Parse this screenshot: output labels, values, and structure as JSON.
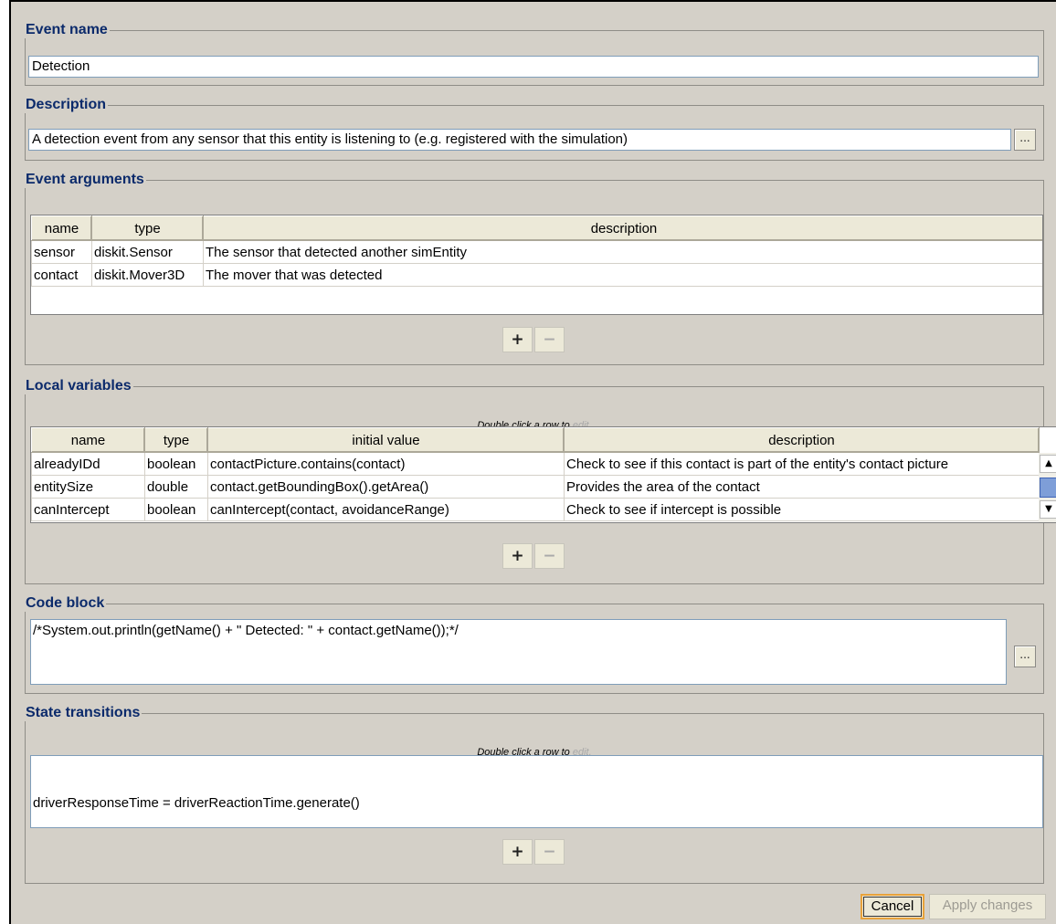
{
  "event_name": {
    "legend": "Event name",
    "value": "Detection"
  },
  "description": {
    "legend": "Description",
    "value": "A detection event from any sensor that this entity is listening to (e.g. registered with the simulation)",
    "more_label": "..."
  },
  "hint": {
    "prefix": "Double click a row to",
    "edit": "edit."
  },
  "event_arguments": {
    "legend": "Event arguments",
    "columns": [
      "name",
      "type",
      "description"
    ],
    "rows": [
      [
        "sensor",
        "diskit.Sensor",
        "The sensor that detected another simEntity"
      ],
      [
        "contact",
        "diskit.Mover3D",
        "The mover that was detected"
      ]
    ]
  },
  "local_variables": {
    "legend": "Local variables",
    "columns": [
      "name",
      "type",
      "initial value",
      "description"
    ],
    "rows": [
      [
        "alreadyIDd",
        "boolean",
        "contactPicture.contains(contact)",
        "Check to see if this contact is part of the entity's contact picture"
      ],
      [
        "entitySize",
        "double",
        "contact.getBoundingBox().getArea()",
        "Provides the area of the contact"
      ],
      [
        "canIntercept",
        "boolean",
        "canIntercept(contact, avoidanceRange)",
        "Check to see if intercept is possible"
      ]
    ]
  },
  "code_block": {
    "legend": "Code block",
    "value": "/*System.out.println(getName() + \" Detected: \" + contact.getName());*/",
    "more_label": "..."
  },
  "state_transitions": {
    "legend": "State transitions",
    "items": [
      "driverResponseTime = driverReactionTime.generate()"
    ]
  },
  "controls": {
    "plus": "+",
    "minus": "−"
  },
  "buttons": {
    "cancel": "Cancel",
    "apply": "Apply changes"
  }
}
